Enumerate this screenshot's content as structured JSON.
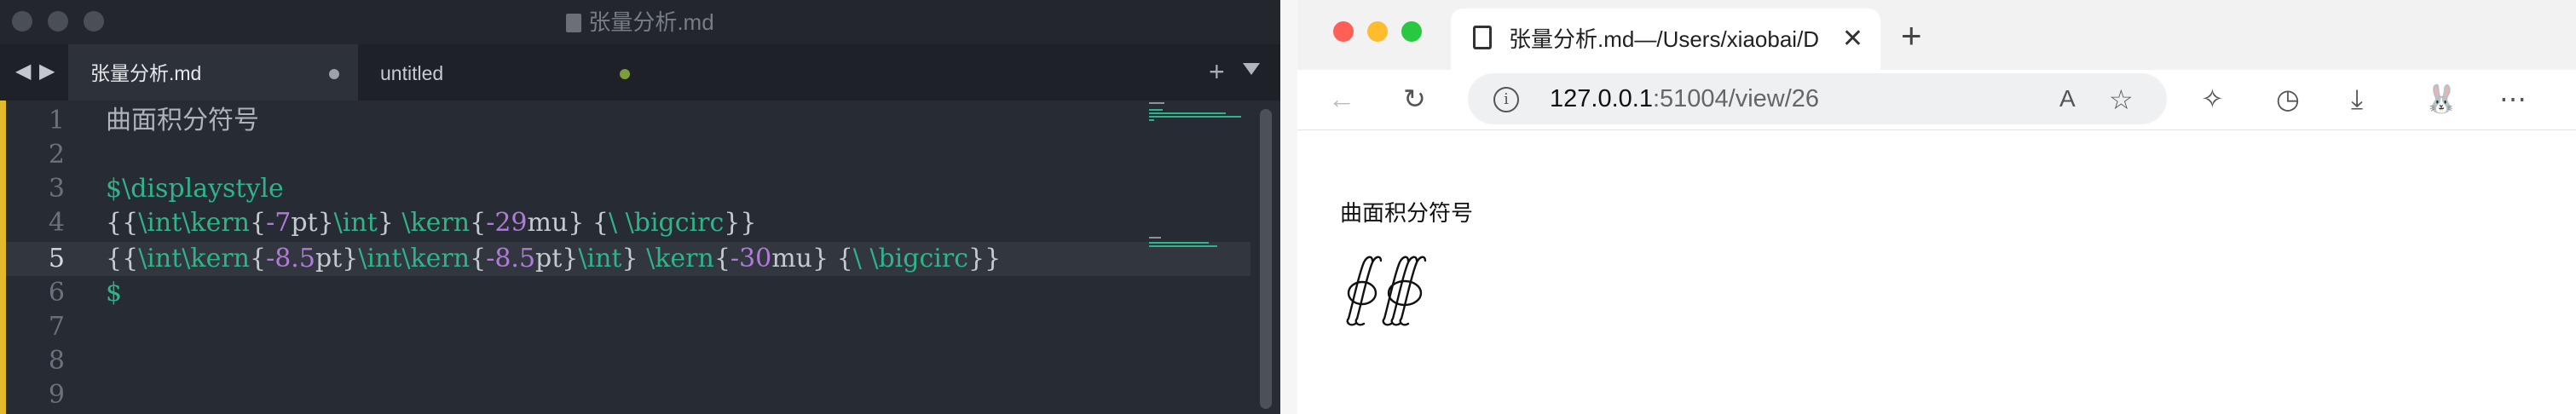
{
  "editor": {
    "title": "张量分析.md",
    "tabs": [
      {
        "label": "张量分析.md"
      },
      {
        "label": "untitled"
      }
    ],
    "lines": [
      {
        "num": "1",
        "text": "曲面积分符号"
      },
      {
        "num": "2",
        "text": ""
      },
      {
        "num": "3",
        "text": "$\\displaystyle"
      },
      {
        "num": "4",
        "text": "{{\\int\\kern{-7pt}\\int} \\kern{-29mu} {\\ \\bigcirc}}"
      },
      {
        "num": "5",
        "text": "{{\\int\\kern{-8.5pt}\\int\\kern{-8.5pt}\\int} \\kern{-30mu} {\\ \\bigcirc}}"
      },
      {
        "num": "6",
        "text": "$"
      },
      {
        "num": "7",
        "text": ""
      },
      {
        "num": "8",
        "text": ""
      },
      {
        "num": "9",
        "text": ""
      }
    ],
    "current_line": 5,
    "colors": {
      "keyword": "#2fb48a",
      "number": "#b07ad8",
      "gutter_mark": "#e2b92a"
    }
  },
  "browser": {
    "tab_title": "张量分析.md—/Users/xiaobai/D",
    "url_host": "127.0.0.1",
    "url_rest": ":51004/view/26",
    "page": {
      "heading": "曲面积分符号"
    }
  }
}
